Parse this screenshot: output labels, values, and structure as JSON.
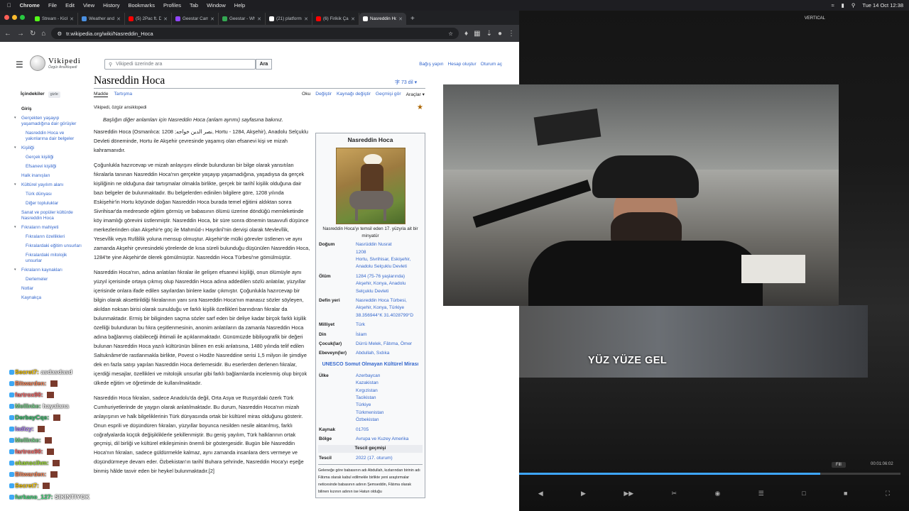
{
  "menubar": {
    "app": "Chrome",
    "items": [
      "File",
      "Edit",
      "View",
      "History",
      "Bookmarks",
      "Profiles",
      "Tab",
      "Window",
      "Help"
    ],
    "clock": "Tue 14 Oct  12:38"
  },
  "tabs": [
    {
      "title": "Stream - Kick D",
      "color": "#53fc18"
    },
    {
      "title": "Weather and p",
      "color": "#4a90e2"
    },
    {
      "title": "(5) 2Pac ft. Dr",
      "color": "#ff0000"
    },
    {
      "title": "Geestar Camp",
      "color": "#9146ff"
    },
    {
      "title": "Geestar - Whi",
      "color": "#34a853"
    },
    {
      "title": "(21) platform o",
      "color": "#ffffff"
    },
    {
      "title": "(6) Firikik Çalış",
      "color": "#ff0000"
    },
    {
      "title": "Nasreddin Hoc",
      "color": "#ffffff",
      "active": true
    }
  ],
  "address": "tr.wikipedia.org/wiki/Nasreddin_Hoca",
  "wiki": {
    "wordmark": "Vikipedi",
    "tagline_logo": "Özgür Ansiklopedi",
    "search_placeholder": "Vikipedi üzerinde ara",
    "search_button": "Ara",
    "user_links": [
      "Bağış yapın",
      "Hesap oluştur",
      "Oturum aç"
    ],
    "title": "Nasreddin Hoca",
    "langs": "73 dil",
    "ns_tabs": [
      "Madde",
      "Tartışma"
    ],
    "view_tabs": [
      "Oku",
      "Değiştir",
      "Kaynağı değiştir",
      "Geçmişi gör",
      "Araçlar"
    ],
    "tagline": "Vikipedi, özgür ansiklopedi",
    "toc_title": "İçindekiler",
    "toc_hide": "gizle",
    "toc": [
      {
        "label": "Giriş",
        "lvl": 0,
        "bold": true
      },
      {
        "label": "Gerçekten yaşayıp yaşamadığına dair görüşler",
        "lvl": 0,
        "tw": "v"
      },
      {
        "label": "Nasreddin Hoca ve yakınlarına dair belgeler",
        "lvl": 1
      },
      {
        "label": "Kişiliği",
        "lvl": 0,
        "tw": "v"
      },
      {
        "label": "Gerçek kişiliği",
        "lvl": 1
      },
      {
        "label": "Efsanevi kişiliği",
        "lvl": 1
      },
      {
        "label": "Halk inanışları",
        "lvl": 0
      },
      {
        "label": "Kültürel yayılım alanı",
        "lvl": 0,
        "tw": "v"
      },
      {
        "label": "Türk dünyası",
        "lvl": 1
      },
      {
        "label": "Diğer topluluklar",
        "lvl": 1
      },
      {
        "label": "Sanat ve popüler kültürde Nasreddin Hoca",
        "lvl": 0
      },
      {
        "label": "Fıkraların mahiyeti",
        "lvl": 0,
        "tw": "v"
      },
      {
        "label": "Fıkraların özellikleri",
        "lvl": 1
      },
      {
        "label": "Fıkralardaki eğitim unsurları",
        "lvl": 1
      },
      {
        "label": "Fıkralardaki mitolojik unsurlar",
        "lvl": 1
      },
      {
        "label": "Fıkraların kaynakları",
        "lvl": 0,
        "tw": "v"
      },
      {
        "label": "Derlemeler",
        "lvl": 1
      },
      {
        "label": "Notlar",
        "lvl": 0
      },
      {
        "label": "Kaynakça",
        "lvl": 0
      }
    ],
    "hatnote": "Başlığın diğer anlamları için Nasreddin Hoca (anlam ayrımı) sayfasına bakınız.",
    "paragraphs": [
      "Nasreddin Hoca (Osmanlıca: نصر الدين خواجه; 1208, Hortu - 1284, Akşehir), Anadolu Selçuklu Devleti döneminde, Hortu ile Akşehir çevresinde yaşamış olan efsanevi kişi ve mizah kahramanıdır.",
      "Çoğunlukla hazırcevap ve mizah anlayışını elinde bulunduran bir bilge olarak yansıtılan fıkralarla tanınan Nasreddin Hoca'nın gerçekte yaşayıp yaşamadığına, yaşadıysa da gerçek kişiliğinin ne olduğuna dair tartışmalar olmakla birlikte, gerçek bir tarihî kişilik olduğuna dair bazı belgeler de bulunmaktadır. Bu belgelerden edinilen bilgilere göre, 1208 yılında Eskişehir'in Hortu köyünde doğan Nasreddin Hoca burada temel eğitimi aldıktan sonra Sivrihisar'da medresede eğitim görmüş ve babasının ölümü üzerine döndüğü memleketinde köy imamlığı görevini üstlenmiştir. Nasreddin Hoca, bir süre sonra dönemin tasavvufi düşünce merkezlerinden olan Akşehir'e göç ile Mahmûd-ı Hayrânî'nin dervişi olarak Mevlevîlik, Yesevîlik veya Rufâîlik yoluna mensup olmuştur. Akşehir'de mülki görevler üstlenen ve aynı zamanda Akşehir çevresindeki yörelerde de kısa süreli bulunduğu düşünülen Nasreddin Hoca, 1284'te yine Akşehir'de ölerek gömülmüştür. Nasreddin Hoca Türbesi'ne gömülmüştür.",
      "Nasreddin Hoca'nın, adına anlatılan fıkralar ile gelişen efsanevi kişiliği, onun ölümüyle aynı yüzyıl içerisinde ortaya çıkmış olup Nasreddin Hoca adına addedilen sözlü anlatılar, yüzyıllar içerisinde onlara ifade edilen sayılardan binlere kadar çıkmıştır. Çoğunlukla hazırcevap bir bilgin olarak aksettirildiği fıkralarının yanı sıra Nasreddin Hoca'nın manasız sözler söyleyen, akıldan noksan birisi olarak sunulduğu ve farklı kişilik özellikleri barındıran fıkralar da bulunmaktadır. Ermiş bir biliginden saçma sözler sarf eden bir deliye kadar birçok farklı kişilik özelliği bulunduran bu fıkra çeşitlenmesinin, anonim anlatıların da zamanla Nasreddin Hoca adına bağlanmış olabileceği ihtimali ile açıklanmaktadır. Günümüzde bibliyografik bir değeri bulunan Nasreddin Hoca yazılı kültürünün bilinen en eski anlatısına, 1480 yılında telif edilen Saltuknâme'de rastlanmakla birlikte, Povest o Hodže Nasreddine serisi 1,5 milyon ile şimdiye dek en fazla satışı yapılan Nasreddin Hoca derlemesidir. Bu eserlerden derlenen fıkralar, içerdiği mesajlar, özellikleri ve mitolojik unsurlar gibi farklı bağlamlarda incelenmiş olup birçok ülkede eğitim ve öğretimde de kullanılmaktadır.",
      "Nasreddin Hoca fıkraları, sadece Anadolu'da değil, Orta Asya ve Rusya'daki özerk Türk Cumhuriyetlerinde de yaygın olarak anlatılmaktadır. Bu durum, Nasreddin Hoca'nın mizah anlayışının ve halk bilgeliklerinin Türk dünyasında ortak bir kültürel miras olduğunu gösterir. Onun esprili ve düşündüren fıkraları, yüzyıllar boyunca nesilden nesile aktarılmış, farklı coğrafyalarda küçük değişikliklerle şekillenmiştir. Bu geniş yayılım, Türk halklarının ortak geçmişi, dil birliği ve kültürel etkileşiminin önemli bir göstergesidir. Bugün bile Nasreddin Hoca'nın fıkraları, sadece güldürmekle kalmaz, aynı zamanda insanlara ders vermeye ve düşündürmeye devam eder. Özbekistan'ın tarihî Buhara şehrinde, Nasreddin Hoca'yı eşeğe binmiş hâlde tasvir eden bir heykel bulunmaktadır.[2]"
    ],
    "infobox": {
      "title": "Nasreddin Hoca",
      "caption": "Nasreddin Hoca'yı temsil eden 17. yüzyıla ait bir minyatür",
      "rows": [
        {
          "k": "Doğum",
          "v": "Nasrüddin Nusrat\n1208\nHortu, Sivrihisar, Eskişehir, Anadolu Selçuklu Devleti"
        },
        {
          "k": "Ölüm",
          "v": "1284 (75-76 yaşlarında)\nAkşehir, Konya, Anadolu Selçuklu Devleti"
        },
        {
          "k": "Defin yeri",
          "v": "Nasreddin Hoca Türbesi, Akşehir, Konya, Türkiye\n38.356944°K 31.4028799°D"
        },
        {
          "k": "Milliyet",
          "v": "Türk"
        },
        {
          "k": "Din",
          "v": "İslam"
        },
        {
          "k": "Çocuk(lar)",
          "v": "Dürrü Melek, Fâtıma, Ömer"
        },
        {
          "k": "Ebeveyn(ler)",
          "v": "Abdullah, Sıdıka"
        }
      ],
      "unesco": "UNESCO Somut Olmayan Kültürel Mirası",
      "rows2": [
        {
          "k": "Ülke",
          "v": "Azerbaycan\nKazakistan\nKırgızistan\nTacikistan\nTürkiye\nTürkmenistan\nÖzbekistan"
        },
        {
          "k": "Kaynak",
          "v": "01705"
        },
        {
          "k": "Bölge",
          "v": "Avrupa ve Kuzey Amerika"
        }
      ],
      "history_head": "Tescil geçmişi",
      "rows3": [
        {
          "k": "Tescil",
          "v": "2022 (17. oturum)"
        }
      ],
      "note": "Geleneğe göre babasının adı Abdullah, kızlarından birinin adı Fâtıma olarak kabul edilmekle birlikte yeni araştırmalar neticesinde babasının adının Şemseddin, Fâtıma olarak bilinen kızının adının ise Hatun olduğu"
    }
  },
  "video": {
    "label": "VERTICAL",
    "caption": "YÜZ YÜZE GEL",
    "fit": "Fill",
    "time": "00:01:06:02",
    "progress": 0.79
  },
  "chat": [
    {
      "user": "Secret7:",
      "msg": "asdasdasd",
      "color": "#ffcc00"
    },
    {
      "user": "Bitwarden:",
      "msg": "",
      "color": "#ff8a5b",
      "em": true
    },
    {
      "user": "fartrox90:",
      "msg": "",
      "color": "#ff6b6b",
      "em": true
    },
    {
      "user": "Mellinke:",
      "msg": "hayalana",
      "color": "#7bd88f"
    },
    {
      "user": "DerbayCqs:",
      "msg": "",
      "color": "#36c36b",
      "em": true
    },
    {
      "user": "ladizy:",
      "msg": "",
      "color": "#b78bff",
      "em": true
    },
    {
      "user": "Mellinke:",
      "msg": "",
      "color": "#7bd88f",
      "em": true
    },
    {
      "user": "fartrox90:",
      "msg": "",
      "color": "#ff6b6b",
      "em": true
    },
    {
      "user": "okanscihm:",
      "msg": "",
      "color": "#a3e635",
      "em": true
    },
    {
      "user": "Bitwarden:",
      "msg": "",
      "color": "#ff8a5b",
      "em": true
    },
    {
      "user": "Secret7:",
      "msg": "",
      "color": "#ffcc00",
      "em": true
    },
    {
      "user": "furkano_127:",
      "msg": "SIKINTIYOK",
      "color": "#4ade80"
    }
  ]
}
